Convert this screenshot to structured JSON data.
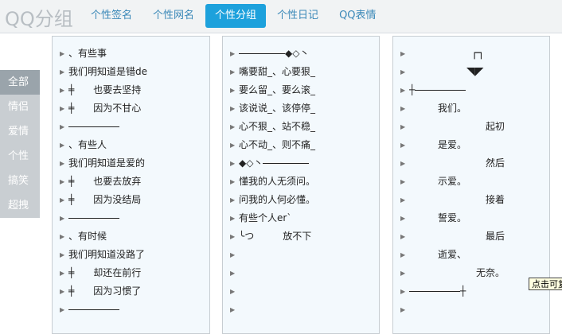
{
  "logo": "QQ分组",
  "nav": [
    {
      "label": "个性签名",
      "active": false
    },
    {
      "label": "个性网名",
      "active": false
    },
    {
      "label": "个性分组",
      "active": true
    },
    {
      "label": "个性日记",
      "active": false
    },
    {
      "label": "QQ表情",
      "active": false
    }
  ],
  "sidebar": [
    {
      "label": "全部",
      "active": true
    },
    {
      "label": "情侣",
      "active": false
    },
    {
      "label": "爱情",
      "active": false
    },
    {
      "label": "个性",
      "active": false
    },
    {
      "label": "搞笑",
      "active": false
    },
    {
      "label": "超拽",
      "active": false
    }
  ],
  "column1": [
    "、有些事",
    "我们明知道是错de",
    "╪　　也要去坚持",
    "╪　　因为不甘心",
    "",
    "、有些人",
    "我们明知道是爱的",
    "╪　　也要去放弃",
    "╪　　因为没结局",
    "",
    "、有时候",
    "我们明知道没路了",
    "╪　　却还在前行",
    "╪　　因为习惯了",
    ""
  ],
  "column2": [
    "◆◇丶",
    "嘴要甜_、心要狠_",
    "要么留_、要么滚_",
    "该说说_、该停停_",
    "心不狠_、站不稳_",
    "心不动_、则不痛_",
    "◆◇丶",
    "懂我的人无须问。",
    "问我的人何必懂。",
    "有些个人er`",
    "╰つ　　　放不下",
    "",
    "",
    "",
    ""
  ],
  "column3": [
    "┌┐",
    "◥◤",
    "┼",
    "　　　我们。",
    "　　　　　　　　起初",
    "　　　是爱。",
    "　　　　　　　　然后",
    "　　　示爱。",
    "　　　　　　　　接着",
    "　　　誓爱。",
    "　　　　　　　　最后",
    "　　　逝爱、",
    "　　　　　　　无奈。",
    "┼",
    ""
  ],
  "tooltip": "点击可复制"
}
